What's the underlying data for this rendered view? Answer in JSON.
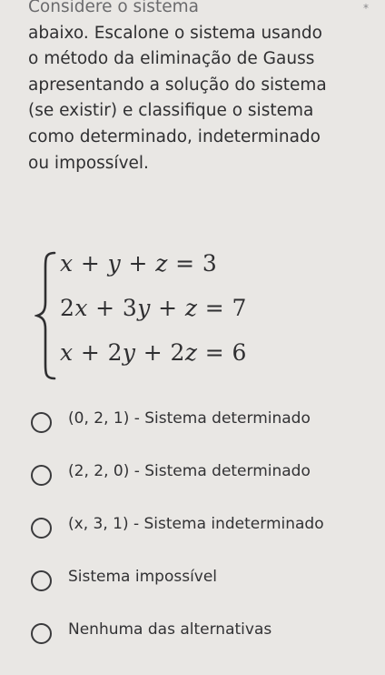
{
  "question": {
    "lines": [
      "Considere o sistema",
      "abaixo. Escalone o sistema usando",
      "o método da eliminação de Gauss",
      "apresentando a solução do sistema",
      "(se existir) e classifique o sistema",
      "como determinado, indeterminado",
      "ou impossível."
    ],
    "required_mark": "*"
  },
  "system": {
    "equations": [
      "x + y + z = 3",
      "2x + 3y + z = 7",
      "x + 2y + 2z = 6"
    ]
  },
  "options": [
    "(0, 2, 1) - Sistema determinado",
    "(2, 2, 0) - Sistema determinado",
    "(x, 3, 1) - Sistema indeterminado",
    "Sistema impossível",
    "Nenhuma das alternativas"
  ]
}
